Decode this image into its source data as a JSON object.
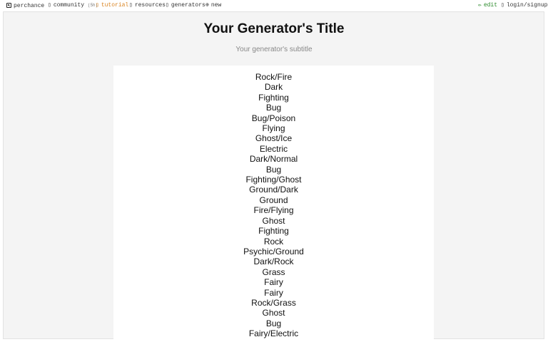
{
  "topbar": {
    "left": [
      {
        "icon": "dice-icon",
        "label": "perchance"
      },
      {
        "icon": "community-icon",
        "label": "community",
        "badge": "(5h)"
      },
      {
        "icon": "tutorial-icon",
        "label": "tutorial"
      },
      {
        "icon": "resources-icon",
        "label": "resources"
      },
      {
        "icon": "generators-icon",
        "label": "generators"
      },
      {
        "icon": "plus-circle-icon",
        "label": "new"
      }
    ],
    "right": [
      {
        "icon": "edit-icon",
        "label": "edit"
      },
      {
        "icon": "login-icon",
        "label": "login/signup"
      }
    ]
  },
  "header": {
    "title": "Your Generator's Title",
    "subtitle": "Your generator's subtitle"
  },
  "output": {
    "items": [
      "Rock/Fire",
      "Dark",
      "Fighting",
      "Bug",
      "Bug/Poison",
      "Flying",
      "Ghost/Ice",
      "Electric",
      "Dark/Normal",
      "Bug",
      "Fighting/Ghost",
      "Ground/Dark",
      "Ground",
      "Fire/Flying",
      "Ghost",
      "Fighting",
      "Rock",
      "Psychic/Ground",
      "Dark/Rock",
      "Grass",
      "Fairy",
      "Fairy",
      "Rock/Grass",
      "Ghost",
      "Bug",
      "Fairy/Electric"
    ]
  },
  "colors": {
    "tutorial": "#d9831f",
    "edit": "#2a8a2a",
    "frame_bg": "#f4f4f4"
  }
}
